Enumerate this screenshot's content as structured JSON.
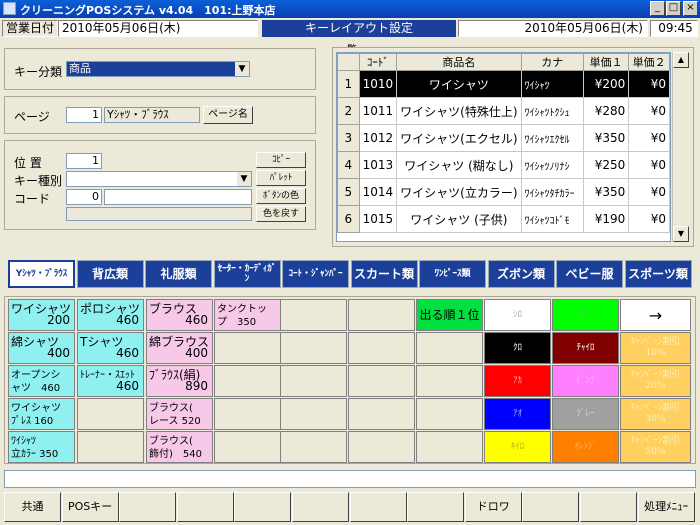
{
  "window": {
    "title": "クリーニングPOSシステム v4.04　101:上野本店"
  },
  "header": {
    "business_date_label": "営業日付",
    "business_date": "2010年05月06日(木)",
    "screen_title": "キーレイアウト設定",
    "current_date": "2010年05月06日(木)",
    "time": "09:45"
  },
  "form": {
    "key_category_label": "キー分類",
    "key_category_value": "商品",
    "page_label": "ページ",
    "page_value": "1",
    "page_name": "Yｼｬﾂ・ﾌﾞﾗｳｽ",
    "page_name_button": "ページ名",
    "position_label": "位 置",
    "position_value": "1",
    "key_type_label": "キー種別",
    "key_type_value": "",
    "code_label": "コード",
    "code_value": "0",
    "code_name_value": "",
    "extra_field": "",
    "btn_copy": "ｺﾋﾟｰ",
    "btn_palette": "ﾊﾟﾚｯﾄ",
    "btn_key_color": "ﾎﾞﾀﾝの色",
    "btn_reset_color": "色を戻す"
  },
  "list": {
    "group_label": "一覧",
    "columns": [
      "ｺｰﾄﾞ",
      "商品名",
      "カナ",
      "単価１",
      "単価２"
    ],
    "rows": [
      {
        "no": "1",
        "code": "1010",
        "name": "ワイシャツ",
        "kana": "ﾜｲｼｬﾂ",
        "price1": "¥200",
        "price2": "¥0"
      },
      {
        "no": "2",
        "code": "1011",
        "name": "ワイシャツ(特殊仕上)",
        "kana": "ﾜｲｼｬﾂﾄｸｼｭ",
        "price1": "¥280",
        "price2": "¥0"
      },
      {
        "no": "3",
        "code": "1012",
        "name": "ワイシャツ(エクセル)",
        "kana": "ﾜｲｼｬﾂｴｸｾﾙ",
        "price1": "¥350",
        "price2": "¥0"
      },
      {
        "no": "4",
        "code": "1013",
        "name": "ワイシャツ (糊なし)",
        "kana": "ﾜｲｼｬﾂﾉﾘﾅｼ",
        "price1": "¥250",
        "price2": "¥0"
      },
      {
        "no": "5",
        "code": "1014",
        "name": "ワイシャツ(立カラー)",
        "kana": "ﾜｲｼｬﾂﾀﾁｶﾗｰ",
        "price1": "¥350",
        "price2": "¥0"
      },
      {
        "no": "6",
        "code": "1015",
        "name": "ワイシャツ (子供)",
        "kana": "ﾜｲｼｬﾂｺﾄﾞﾓ",
        "price1": "¥190",
        "price2": "¥0"
      }
    ]
  },
  "categories": [
    {
      "label": "Yｼｬﾂ・ﾌﾞﾗｳｽ",
      "active": true
    },
    {
      "label": "背広類"
    },
    {
      "label": "礼服類"
    },
    {
      "label": "ｾｰﾀｰ・ｶｰﾃﾞｨｶﾞﾝ"
    },
    {
      "label": "ｺｰﾄ・ｼﾞｬﾝﾊﾟｰ"
    },
    {
      "label": "スカート類"
    },
    {
      "label": "ﾜﾝﾋﾟｰｽ類"
    },
    {
      "label": "ズボン類"
    },
    {
      "label": "ベビー服"
    },
    {
      "label": "スポーツ類"
    }
  ],
  "keys": [
    {
      "name": "ワイシャツ",
      "price": "200",
      "color": "#8ff0f0"
    },
    {
      "name": "ポロシャツ",
      "price": "460",
      "color": "#8ff0f0"
    },
    {
      "name": "ブラウス",
      "price": "460",
      "color": "#f8c8e8"
    },
    {
      "name": "タンクトッ\nプ　350",
      "price": "",
      "color": "#f8c8e8"
    },
    {
      "name": "綿シャツ",
      "price": "400",
      "color": "#8ff0f0"
    },
    {
      "name": "Tシャツ",
      "price": "460",
      "color": "#8ff0f0"
    },
    {
      "name": "綿ブラウス",
      "price": "400",
      "color": "#f8c8e8"
    },
    {
      "name": "オープンシ\nャツ　460",
      "price": "",
      "color": "#8ff0f0"
    },
    {
      "name": "ﾄﾚｰﾅｰ・ｽｴｯﾄ",
      "price": "460",
      "color": "#8ff0f0"
    },
    {
      "name": "ﾌﾞﾗｳｽ(絹)",
      "price": "890",
      "color": "#f8c8e8"
    },
    {
      "name": "ワイシャツ\nﾌﾟﾚｽ 160",
      "price": "",
      "color": "#8ff0f0"
    },
    {
      "name": "ブラウス(\nレース 520",
      "price": "",
      "color": "#f8c8e8"
    },
    {
      "name": "ﾜｲｼｬﾂ\n立ｶﾗｰ 350",
      "price": "",
      "color": "#8ff0f0"
    },
    {
      "name": "ブラウス(\n飾付)　540",
      "price": "",
      "color": "#f8c8e8"
    }
  ],
  "order_button": "出る順１位",
  "colors": [
    {
      "label": "ｼﾛ",
      "bg": "#ffffff",
      "fg": "#aaaaaa"
    },
    {
      "label": "ﾐﾄﾞﾘ",
      "bg": "#00ff00",
      "fg": "#55cc55"
    },
    {
      "label": "ｸﾛ",
      "bg": "#000000",
      "fg": "#ffffff"
    },
    {
      "label": "ﾁｬｲﾛ",
      "bg": "#800000",
      "fg": "#ffffff"
    },
    {
      "label": "ｱｶ",
      "bg": "#ff0000",
      "fg": "#ffaaaa"
    },
    {
      "label": "ﾋﾟﾝｸ",
      "bg": "#ff80ff",
      "fg": "#ffb0ff"
    },
    {
      "label": "ｱｵ",
      "bg": "#0000ff",
      "fg": "#aaaaff"
    },
    {
      "label": "ｸﾞﾚｰ",
      "bg": "#a0a0a0",
      "fg": "#d0d0d0"
    },
    {
      "label": "ｷｲﾛ",
      "bg": "#ffff00",
      "fg": "#aaaa44"
    },
    {
      "label": "ｵﾚﾝｼﾞ",
      "bg": "#ff8000",
      "fg": "#ffb060"
    }
  ],
  "campaigns": [
    {
      "label": "→"
    },
    {
      "label": "ｷｬﾝﾍﾟｰﾝ割引\n10%"
    },
    {
      "label": "ｷｬﾝﾍﾟｰﾝ割引\n20%"
    },
    {
      "label": "ｷｬﾝﾍﾟｰﾝ割引\n30%"
    },
    {
      "label": "ｷｬﾝﾍﾟｰﾝ割引\n50%"
    }
  ],
  "fkeys": [
    "共通",
    "POSキー",
    "",
    "",
    "",
    "",
    "",
    "",
    "ドロワ",
    "",
    "",
    "処理ﾒﾆｭｰ"
  ],
  "accent": "#1c3f9a"
}
